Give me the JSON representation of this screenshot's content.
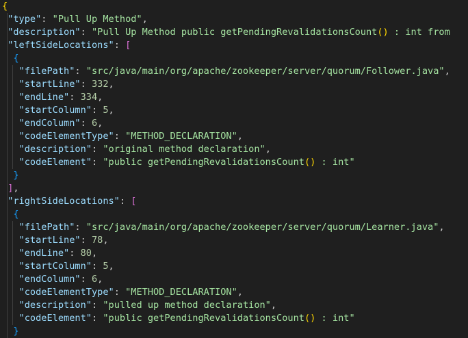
{
  "editor": {
    "lines": [
      {
        "indent": "",
        "parts": [
          {
            "t": "{",
            "c": "b1"
          }
        ]
      },
      {
        "indent": " ",
        "parts": [
          {
            "t": "\"type\"",
            "c": "k"
          },
          {
            "t": ": ",
            "c": "p"
          },
          {
            "t": "\"Pull Up Method\"",
            "c": "str"
          },
          {
            "t": ",",
            "c": "p"
          }
        ]
      },
      {
        "indent": " ",
        "parts": [
          {
            "t": "\"description\"",
            "c": "k"
          },
          {
            "t": ": ",
            "c": "p"
          },
          {
            "t": "\"Pull Up Method public getPendingRevalidationsCount",
            "c": "str"
          },
          {
            "t": "()",
            "c": "b1"
          },
          {
            "t": " : int from",
            "c": "str"
          }
        ]
      },
      {
        "indent": " ",
        "parts": [
          {
            "t": "\"leftSideLocations\"",
            "c": "k"
          },
          {
            "t": ": ",
            "c": "p"
          },
          {
            "t": "[",
            "c": "b2"
          }
        ]
      },
      {
        "indent": "  ",
        "parts": [
          {
            "t": "{",
            "c": "b3"
          }
        ]
      },
      {
        "indent": "   ",
        "parts": [
          {
            "t": "\"filePath\"",
            "c": "k"
          },
          {
            "t": ": ",
            "c": "p"
          },
          {
            "t": "\"src/java/main/org/apache/zookeeper/server/quorum/Follower.java\"",
            "c": "str"
          },
          {
            "t": ",",
            "c": "p"
          }
        ]
      },
      {
        "indent": "   ",
        "parts": [
          {
            "t": "\"startLine\"",
            "c": "k"
          },
          {
            "t": ": ",
            "c": "p"
          },
          {
            "t": "332",
            "c": "num"
          },
          {
            "t": ",",
            "c": "p"
          }
        ]
      },
      {
        "indent": "   ",
        "parts": [
          {
            "t": "\"endLine\"",
            "c": "k"
          },
          {
            "t": ": ",
            "c": "p"
          },
          {
            "t": "334",
            "c": "num"
          },
          {
            "t": ",",
            "c": "p"
          }
        ]
      },
      {
        "indent": "   ",
        "parts": [
          {
            "t": "\"startColumn\"",
            "c": "k"
          },
          {
            "t": ": ",
            "c": "p"
          },
          {
            "t": "5",
            "c": "num"
          },
          {
            "t": ",",
            "c": "p"
          }
        ]
      },
      {
        "indent": "   ",
        "parts": [
          {
            "t": "\"endColumn\"",
            "c": "k"
          },
          {
            "t": ": ",
            "c": "p"
          },
          {
            "t": "6",
            "c": "num"
          },
          {
            "t": ",",
            "c": "p"
          }
        ]
      },
      {
        "indent": "   ",
        "parts": [
          {
            "t": "\"codeElementType\"",
            "c": "k"
          },
          {
            "t": ": ",
            "c": "p"
          },
          {
            "t": "\"METHOD_DECLARATION\"",
            "c": "str"
          },
          {
            "t": ",",
            "c": "p"
          }
        ]
      },
      {
        "indent": "   ",
        "parts": [
          {
            "t": "\"description\"",
            "c": "k"
          },
          {
            "t": ": ",
            "c": "p"
          },
          {
            "t": "\"original method declaration\"",
            "c": "str"
          },
          {
            "t": ",",
            "c": "p"
          }
        ]
      },
      {
        "indent": "   ",
        "parts": [
          {
            "t": "\"codeElement\"",
            "c": "k"
          },
          {
            "t": ": ",
            "c": "p"
          },
          {
            "t": "\"public getPendingRevalidationsCount",
            "c": "str"
          },
          {
            "t": "()",
            "c": "b1"
          },
          {
            "t": " : int\"",
            "c": "str"
          }
        ]
      },
      {
        "indent": "  ",
        "parts": [
          {
            "t": "}",
            "c": "b3"
          }
        ]
      },
      {
        "indent": " ",
        "parts": [
          {
            "t": "]",
            "c": "b2"
          },
          {
            "t": ",",
            "c": "p"
          }
        ]
      },
      {
        "indent": " ",
        "parts": [
          {
            "t": "\"rightSideLocations\"",
            "c": "k"
          },
          {
            "t": ": ",
            "c": "p"
          },
          {
            "t": "[",
            "c": "b2"
          }
        ]
      },
      {
        "indent": "  ",
        "parts": [
          {
            "t": "{",
            "c": "b3"
          }
        ]
      },
      {
        "indent": "   ",
        "parts": [
          {
            "t": "\"filePath\"",
            "c": "k"
          },
          {
            "t": ": ",
            "c": "p"
          },
          {
            "t": "\"src/java/main/org/apache/zookeeper/server/quorum/Learner.java\"",
            "c": "str"
          },
          {
            "t": ",",
            "c": "p"
          }
        ]
      },
      {
        "indent": "   ",
        "parts": [
          {
            "t": "\"startLine\"",
            "c": "k"
          },
          {
            "t": ": ",
            "c": "p"
          },
          {
            "t": "78",
            "c": "num"
          },
          {
            "t": ",",
            "c": "p"
          }
        ]
      },
      {
        "indent": "   ",
        "parts": [
          {
            "t": "\"endLine\"",
            "c": "k"
          },
          {
            "t": ": ",
            "c": "p"
          },
          {
            "t": "80",
            "c": "num"
          },
          {
            "t": ",",
            "c": "p"
          }
        ]
      },
      {
        "indent": "   ",
        "parts": [
          {
            "t": "\"startColumn\"",
            "c": "k"
          },
          {
            "t": ": ",
            "c": "p"
          },
          {
            "t": "5",
            "c": "num"
          },
          {
            "t": ",",
            "c": "p"
          }
        ]
      },
      {
        "indent": "   ",
        "parts": [
          {
            "t": "\"endColumn\"",
            "c": "k"
          },
          {
            "t": ": ",
            "c": "p"
          },
          {
            "t": "6",
            "c": "num"
          },
          {
            "t": ",",
            "c": "p"
          }
        ]
      },
      {
        "indent": "   ",
        "parts": [
          {
            "t": "\"codeElementType\"",
            "c": "k"
          },
          {
            "t": ": ",
            "c": "p"
          },
          {
            "t": "\"METHOD_DECLARATION\"",
            "c": "str"
          },
          {
            "t": ",",
            "c": "p"
          }
        ]
      },
      {
        "indent": "   ",
        "parts": [
          {
            "t": "\"description\"",
            "c": "k"
          },
          {
            "t": ": ",
            "c": "p"
          },
          {
            "t": "\"pulled up method declaration\"",
            "c": "str"
          },
          {
            "t": ",",
            "c": "p"
          }
        ]
      },
      {
        "indent": "   ",
        "parts": [
          {
            "t": "\"codeElement\"",
            "c": "k"
          },
          {
            "t": ": ",
            "c": "p"
          },
          {
            "t": "\"public getPendingRevalidationsCount",
            "c": "str"
          },
          {
            "t": "()",
            "c": "b1"
          },
          {
            "t": " : int\"",
            "c": "str"
          }
        ]
      },
      {
        "indent": "  ",
        "parts": [
          {
            "t": "}",
            "c": "b3"
          }
        ]
      }
    ]
  },
  "colors": {
    "background": "#1f1f1f",
    "key": "#9cdcfe",
    "string": "#a5e3a1",
    "number": "#b5cea8",
    "bracket_level1": "#ffd700",
    "bracket_level2": "#da70d6",
    "bracket_level3": "#179fff"
  }
}
